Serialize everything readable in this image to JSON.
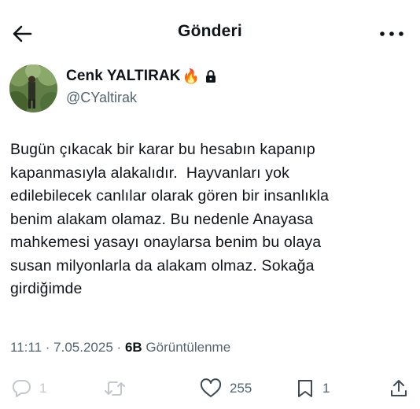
{
  "header": {
    "title": "Gönderi"
  },
  "author": {
    "name": "Cenk YALTIRAK",
    "badge_emoji": "🔥",
    "handle": "@CYaltirak"
  },
  "tweet": {
    "text": "Bugün çıkacak bir karar bu hesabın kapanıp\nkapanmasıyla alakalıdır.  Hayvanları yok\nedilebilecek canlılar olarak gören bir insanlıkla\nbenim alakam olamaz. Bu nedenle Anayasa\nmahkemesi yasayı onaylarsa benim bu olaya\nsusan milyonlarla da alakam olmaz. Sokağa\ngirdiğimde",
    "time": "11:11",
    "date": "7.05.2025",
    "separator": "·",
    "views_count": "6B",
    "views_label": "Görüntülenme"
  },
  "actions": {
    "replies": "1",
    "retweets": "",
    "likes": "255",
    "bookmarks": "1"
  },
  "colors": {
    "text": "#0f1419",
    "secondary": "#536471",
    "background": "#ffffff"
  },
  "icons": {
    "back": "arrow-left-icon",
    "more": "more-dots-icon",
    "lock": "lock-icon",
    "reply": "reply-bubble-icon",
    "retweet": "retweet-icon",
    "like": "heart-icon",
    "bookmark": "bookmark-icon",
    "share": "share-upload-icon"
  }
}
